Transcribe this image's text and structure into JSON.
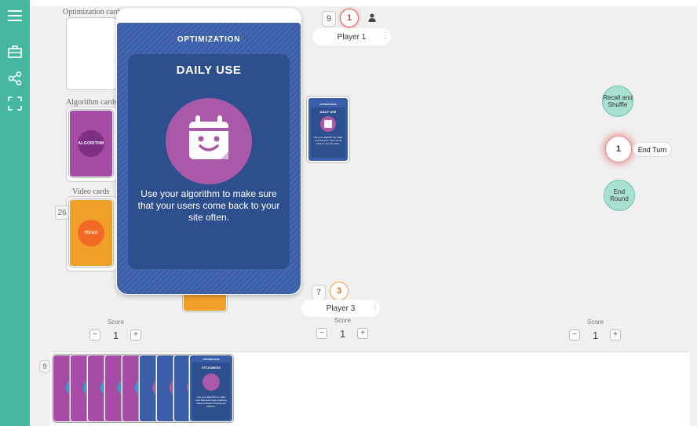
{
  "decks": {
    "optimization_label": "Optimization cards",
    "algorithm_label": "Algorithm cards",
    "algorithm_card_text": "ALGORITHM",
    "video_label": "Video cards",
    "video_count": "26",
    "video_card_text": "VIDEO"
  },
  "big_card": {
    "category": "OPTIMIZATION",
    "title": "DAILY USE",
    "description": "Use your algorithm to make sure that your users come back to your site often.",
    "icon": "calendar-smile-icon"
  },
  "played_card": {
    "category": "OPTIMIZATION",
    "title": "DAILY USE",
    "description": "Use your algorithm to make sure that your users come back to your site often."
  },
  "player1": {
    "card_count": "9",
    "score": "1",
    "name": "Player 1"
  },
  "player3": {
    "card_count": "7",
    "score": "3",
    "name": "Player 3"
  },
  "controls": {
    "recall": "Recall and Shuffle",
    "end_turn_count": "1",
    "end_turn": "End Turn",
    "end_round": "End Round"
  },
  "scores": [
    {
      "label": "Score",
      "value": "1"
    },
    {
      "label": "Score",
      "value": "1"
    },
    {
      "label": "Score",
      "value": "1"
    }
  ],
  "score_minus": "−",
  "score_plus": "+",
  "hand": {
    "count": "9",
    "last_card_category": "OPTIMIZATION",
    "last_card_title": "STICKINESS",
    "last_card_text": "Use your algorithm to make sure that users keep watching videos instead of leaving the platform."
  },
  "colors": {
    "sidebar": "#47b8a0",
    "optimization": "#3a5fa8",
    "algorithm": "#a64ba6",
    "video": "#f0a028",
    "accent_red": "#e06060"
  }
}
